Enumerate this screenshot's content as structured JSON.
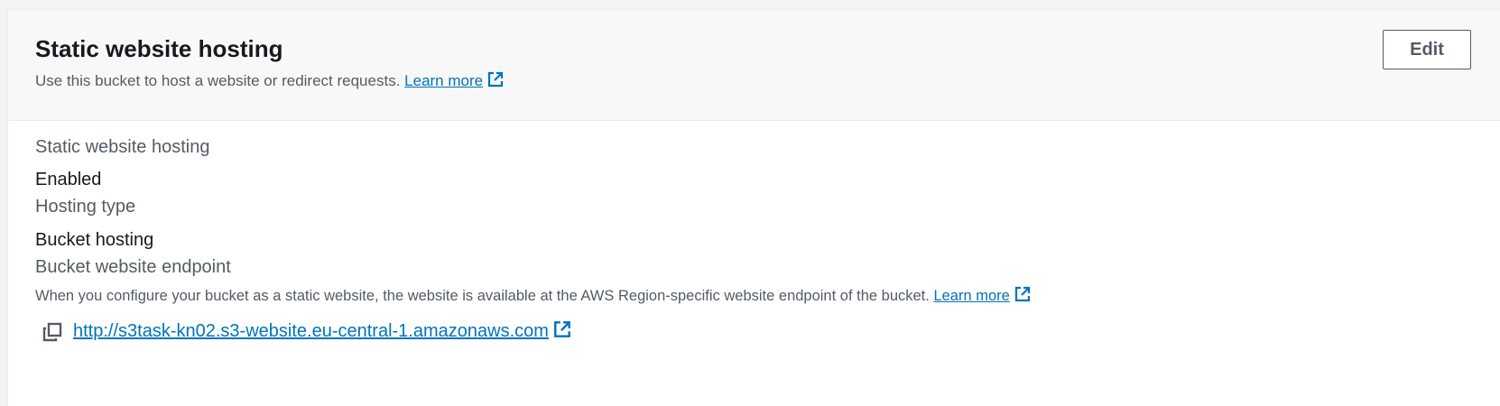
{
  "header": {
    "title": "Static website hosting",
    "description": "Use this bucket to host a website or redirect requests.",
    "learn_more": "Learn more",
    "edit_label": "Edit"
  },
  "fields": {
    "hosting_label": "Static website hosting",
    "hosting_value": "Enabled",
    "type_label": "Hosting type",
    "type_value": "Bucket hosting",
    "endpoint_label": "Bucket website endpoint",
    "endpoint_description": "When you configure your bucket as a static website, the website is available at the AWS Region-specific website endpoint of the bucket.",
    "endpoint_learn_more": "Learn more",
    "endpoint_url": "http://s3task-kn02.s3-website.eu-central-1.amazonaws.com"
  },
  "icons": {
    "external_link": "external-link-icon",
    "copy": "copy-icon"
  },
  "colors": {
    "link": "#0073bb",
    "text_primary": "#16191f",
    "text_secondary": "#545b64",
    "header_bg": "#f8f8f8"
  }
}
